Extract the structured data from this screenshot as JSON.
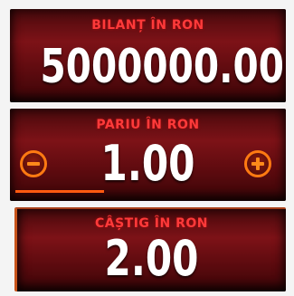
{
  "balance": {
    "label": "BILANȚ ÎN RON",
    "value": "5000000.00"
  },
  "bet": {
    "label": "PARIU ÎN RON",
    "value": "1.00",
    "decrease_icon": "minus-circle-icon",
    "increase_icon": "plus-circle-icon"
  },
  "win": {
    "label": "CÂȘTIG ÎN RON",
    "value": "2.00"
  },
  "colors": {
    "label": "#ff3a3a",
    "value": "#ffffff",
    "accent": "#ff7a12",
    "panel": "#7d1217"
  }
}
